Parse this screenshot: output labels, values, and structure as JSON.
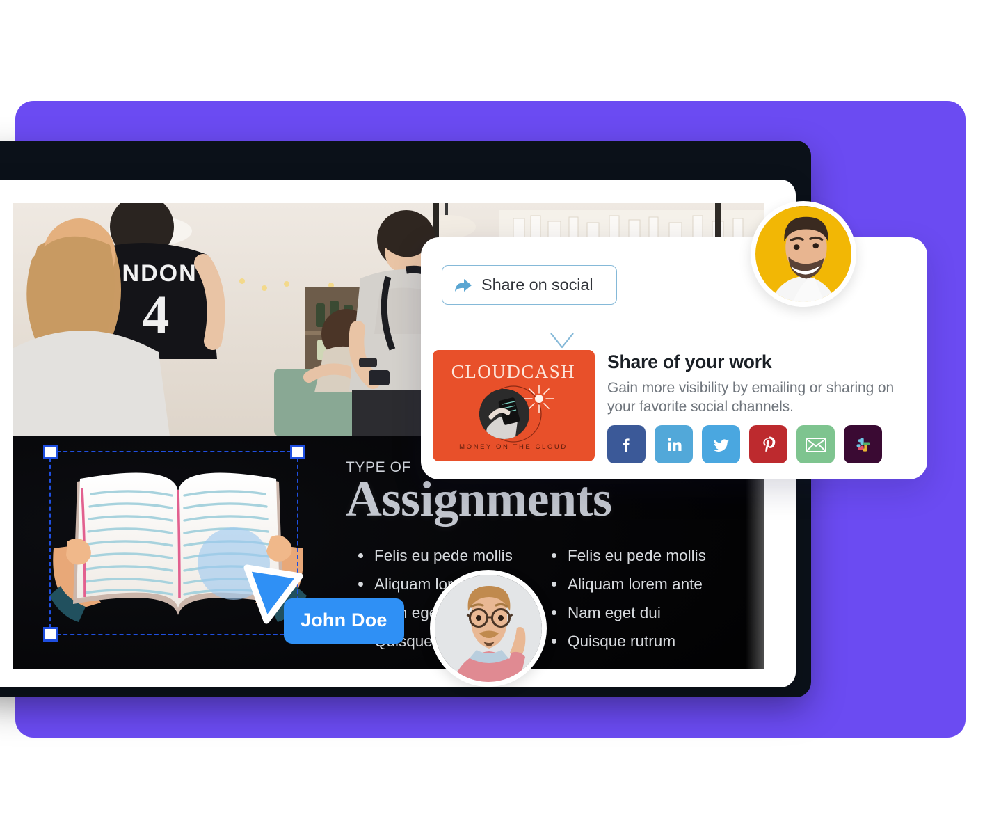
{
  "theme": {
    "backdrop_purple": "#6b4bf2",
    "window_dark": "#0b1119",
    "panel_white": "#ffffff",
    "slide_black": "#050608",
    "selection_blue": "#1f4fe0",
    "cursor_blue": "#2f90f5",
    "tooltip_border_blue": "#85b9d8",
    "thumbnail_orange": "#e8502a",
    "avatar_top_bg": "#f2b705",
    "avatar_bottom_bg": "#e3e5e7"
  },
  "slide": {
    "eyebrow": "TYPE OF",
    "title": "Assignments",
    "bullets_left": [
      "Felis eu pede mollis",
      "Aliquam lorem ante",
      "Nam eget dui",
      "Quisque rutrum"
    ],
    "bullets_right": [
      "Felis eu pede mollis",
      "Aliquam lorem ante",
      "Nam eget dui",
      "Quisque rutrum"
    ]
  },
  "collaborator": {
    "name": "John Doe",
    "cursor_icon": "pointer-cursor-icon"
  },
  "share_popover": {
    "tooltip_label": "Share on social",
    "tooltip_icon": "share-arrow-icon",
    "title": "Share of your work",
    "description": "Gain more visibility by emailing or sharing on your favorite social channels.",
    "thumbnail": {
      "brand": "CLOUDCASH",
      "tagline": "MONEY ON THE CLOUD"
    },
    "social_buttons": [
      {
        "name": "facebook",
        "label": "Facebook",
        "color": "#3b5998"
      },
      {
        "name": "linkedin",
        "label": "LinkedIn",
        "color": "#52a8d9"
      },
      {
        "name": "twitter",
        "label": "Twitter",
        "color": "#4aa7e0"
      },
      {
        "name": "pinterest",
        "label": "Pinterest",
        "color": "#bd2a2e"
      },
      {
        "name": "email",
        "label": "Email",
        "color": "#7ec48f"
      },
      {
        "name": "slack",
        "label": "Slack",
        "color": "#3a0a33"
      }
    ]
  },
  "avatars": [
    {
      "name": "avatar-top",
      "alt": "Smiling man on yellow background"
    },
    {
      "name": "avatar-bottom",
      "alt": "Man with glasses raising finger"
    }
  ]
}
